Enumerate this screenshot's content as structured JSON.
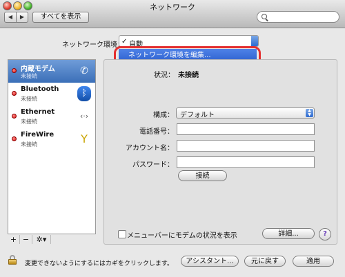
{
  "window": {
    "title": "ネットワーク"
  },
  "toolbar": {
    "back": "◀",
    "forward": "▶",
    "show_all": "すべてを表示",
    "search_placeholder": ""
  },
  "location": {
    "label": "ネットワーク環境：",
    "check": "✓",
    "value": "自動",
    "menu_item": "ネットワーク環境を編集..."
  },
  "sidebar": {
    "items": [
      {
        "name": "内蔵モデム",
        "status": "未接続",
        "icon": "phone-icon",
        "selected": true
      },
      {
        "name": "Bluetooth",
        "status": "未接続",
        "icon": "bluetooth-icon"
      },
      {
        "name": "Ethernet",
        "status": "未接続",
        "icon": "ethernet-icon"
      },
      {
        "name": "FireWire",
        "status": "未接続",
        "icon": "firewire-icon"
      }
    ],
    "buttons": {
      "add": "+",
      "remove": "−",
      "action": "✲▾"
    }
  },
  "detail": {
    "status_label": "状況：",
    "status_value": "未接続",
    "config_label": "構成：",
    "config_value": "デフォルト",
    "phone_label": "電話番号：",
    "account_label": "アカウント名：",
    "password_label": "パスワード：",
    "connect_button": "接続",
    "show_status_label": "メニューバーにモデムの状況を表示",
    "advanced_button": "詳細...",
    "help_button": "?"
  },
  "footer": {
    "lock_text": "変更できないようにするにはカギをクリックします。",
    "assistant_button": "アシスタント...",
    "revert_button": "元に戻す",
    "apply_button": "適用"
  },
  "colors": {
    "selection": "#3b6fb8",
    "highlight": "#2a5fcd",
    "annotation_ring": "#e43030",
    "status_dot": "#dd1111"
  }
}
